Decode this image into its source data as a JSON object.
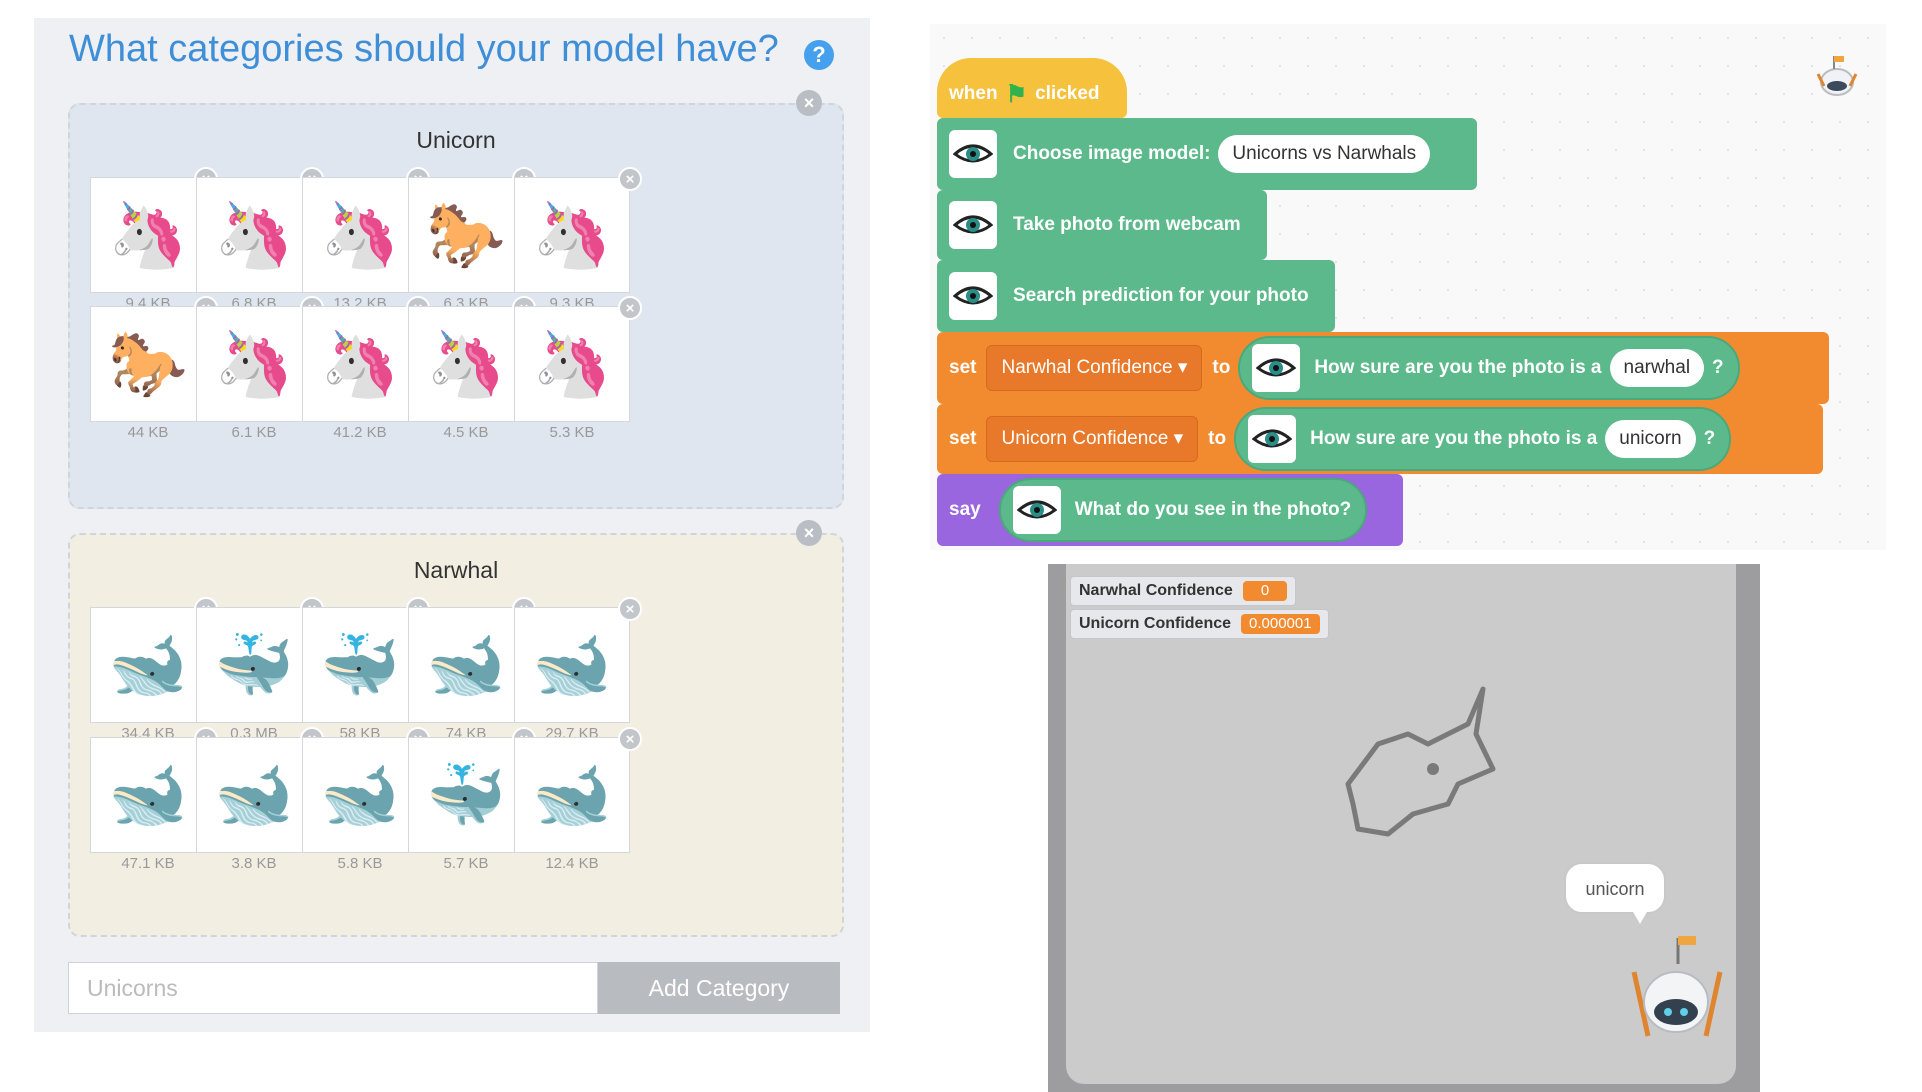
{
  "categories_panel": {
    "title": "What categories should your model have?",
    "help_icon": "?",
    "remove_symbol": "×",
    "categories": [
      {
        "name": "Unicorn",
        "images": [
          {
            "size": "9.4 KB",
            "icon": "🦄"
          },
          {
            "size": "6.8 KB",
            "icon": "🦄"
          },
          {
            "size": "13.2 KB",
            "icon": "🦄"
          },
          {
            "size": "6.3 KB",
            "icon": "🐎"
          },
          {
            "size": "9.3 KB",
            "icon": "🦄"
          },
          {
            "size": "44 KB",
            "icon": "🐎"
          },
          {
            "size": "6.1 KB",
            "icon": "🦄"
          },
          {
            "size": "41.2 KB",
            "icon": "🦄"
          },
          {
            "size": "4.5 KB",
            "icon": "🦄"
          },
          {
            "size": "5.3 KB",
            "icon": "🦄"
          }
        ]
      },
      {
        "name": "Narwhal",
        "images": [
          {
            "size": "34.4 KB",
            "icon": "🐋"
          },
          {
            "size": "0.3 MB",
            "icon": "🐳"
          },
          {
            "size": "58 KB",
            "icon": "🐳"
          },
          {
            "size": "74 KB",
            "icon": "🐋"
          },
          {
            "size": "29.7 KB",
            "icon": "🐋"
          },
          {
            "size": "47.1 KB",
            "icon": "🐋"
          },
          {
            "size": "3.8 KB",
            "icon": "🐋"
          },
          {
            "size": "5.8 KB",
            "icon": "🐋"
          },
          {
            "size": "5.7 KB",
            "icon": "🐳"
          },
          {
            "size": "12.4 KB",
            "icon": "🐋"
          }
        ]
      }
    ],
    "new_category_placeholder": "Unicorns",
    "add_button_label": "Add Category"
  },
  "script": {
    "hat": {
      "when": "when",
      "flag_icon": "⚑",
      "clicked": "clicked"
    },
    "choose_model": {
      "label": "Choose image model:",
      "model": "Unicorns vs Narwhals"
    },
    "take_photo": "Take photo from webcam",
    "search_prediction": "Search prediction for your photo",
    "set_narwhal": {
      "set": "set",
      "variable": "Narwhal Confidence ▾",
      "to": "to",
      "reporter": "How sure are you the photo is a",
      "arg": "narwhal",
      "q": "?"
    },
    "set_unicorn": {
      "set": "set",
      "variable": "Unicorn Confidence ▾",
      "to": "to",
      "reporter": "How sure are you the photo is a",
      "arg": "unicorn",
      "q": "?"
    },
    "say": {
      "say": "say",
      "reporter": "What do you see in the photo?"
    }
  },
  "stage": {
    "monitors": [
      {
        "label": "Narwhal Confidence",
        "value": "0"
      },
      {
        "label": "Unicorn Confidence",
        "value": "0.000001"
      }
    ],
    "speech": "unicorn"
  },
  "colors": {
    "title_blue": "#3f8ed8",
    "events_yellow": "#f6c13c",
    "extension_green": "#5cb98b",
    "variables_orange": "#f28b30",
    "looks_purple": "#9a66e0"
  }
}
